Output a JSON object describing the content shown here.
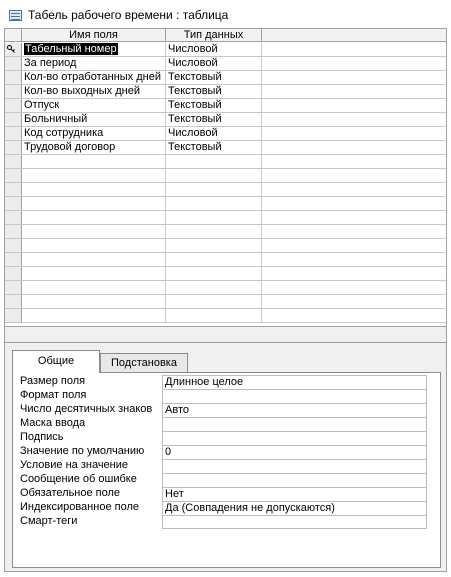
{
  "window": {
    "title": "Табель рабочего времени : таблица"
  },
  "grid": {
    "headers": {
      "field_name": "Имя поля",
      "data_type": "Тип данных"
    },
    "rows": [
      {
        "name": "Табельный номер",
        "type": "Числовой",
        "primary_key": true
      },
      {
        "name": "За период",
        "type": "Числовой"
      },
      {
        "name": "Кол-во отработанных дней",
        "type": "Текстовый"
      },
      {
        "name": "Кол-во выходных дней",
        "type": "Текстовый"
      },
      {
        "name": "Отпуск",
        "type": "Текстовый"
      },
      {
        "name": "Больничный",
        "type": "Текстовый"
      },
      {
        "name": "Код сотрудника",
        "type": "Числовой"
      },
      {
        "name": "Трудовой договор",
        "type": "Текстовый"
      }
    ]
  },
  "properties": {
    "tabs": {
      "general": "Общие",
      "lookup": "Подстановка"
    },
    "rows": [
      {
        "label": "Размер поля",
        "value": "Длинное целое"
      },
      {
        "label": "Формат поля",
        "value": ""
      },
      {
        "label": "Число десятичных знаков",
        "value": "Авто"
      },
      {
        "label": "Маска ввода",
        "value": ""
      },
      {
        "label": "Подпись",
        "value": ""
      },
      {
        "label": "Значение по умолчанию",
        "value": "0"
      },
      {
        "label": "Условие на значение",
        "value": ""
      },
      {
        "label": "Сообщение об ошибке",
        "value": ""
      },
      {
        "label": "Обязательное поле",
        "value": "Нет"
      },
      {
        "label": "Индексированное поле",
        "value": "Да (Совпадения не допускаются)"
      },
      {
        "label": "Смарт-теги",
        "value": ""
      }
    ]
  },
  "colors": {
    "selection": "#000000",
    "border": "#a0a0a0",
    "panel_bg": "#f0f0f0"
  }
}
